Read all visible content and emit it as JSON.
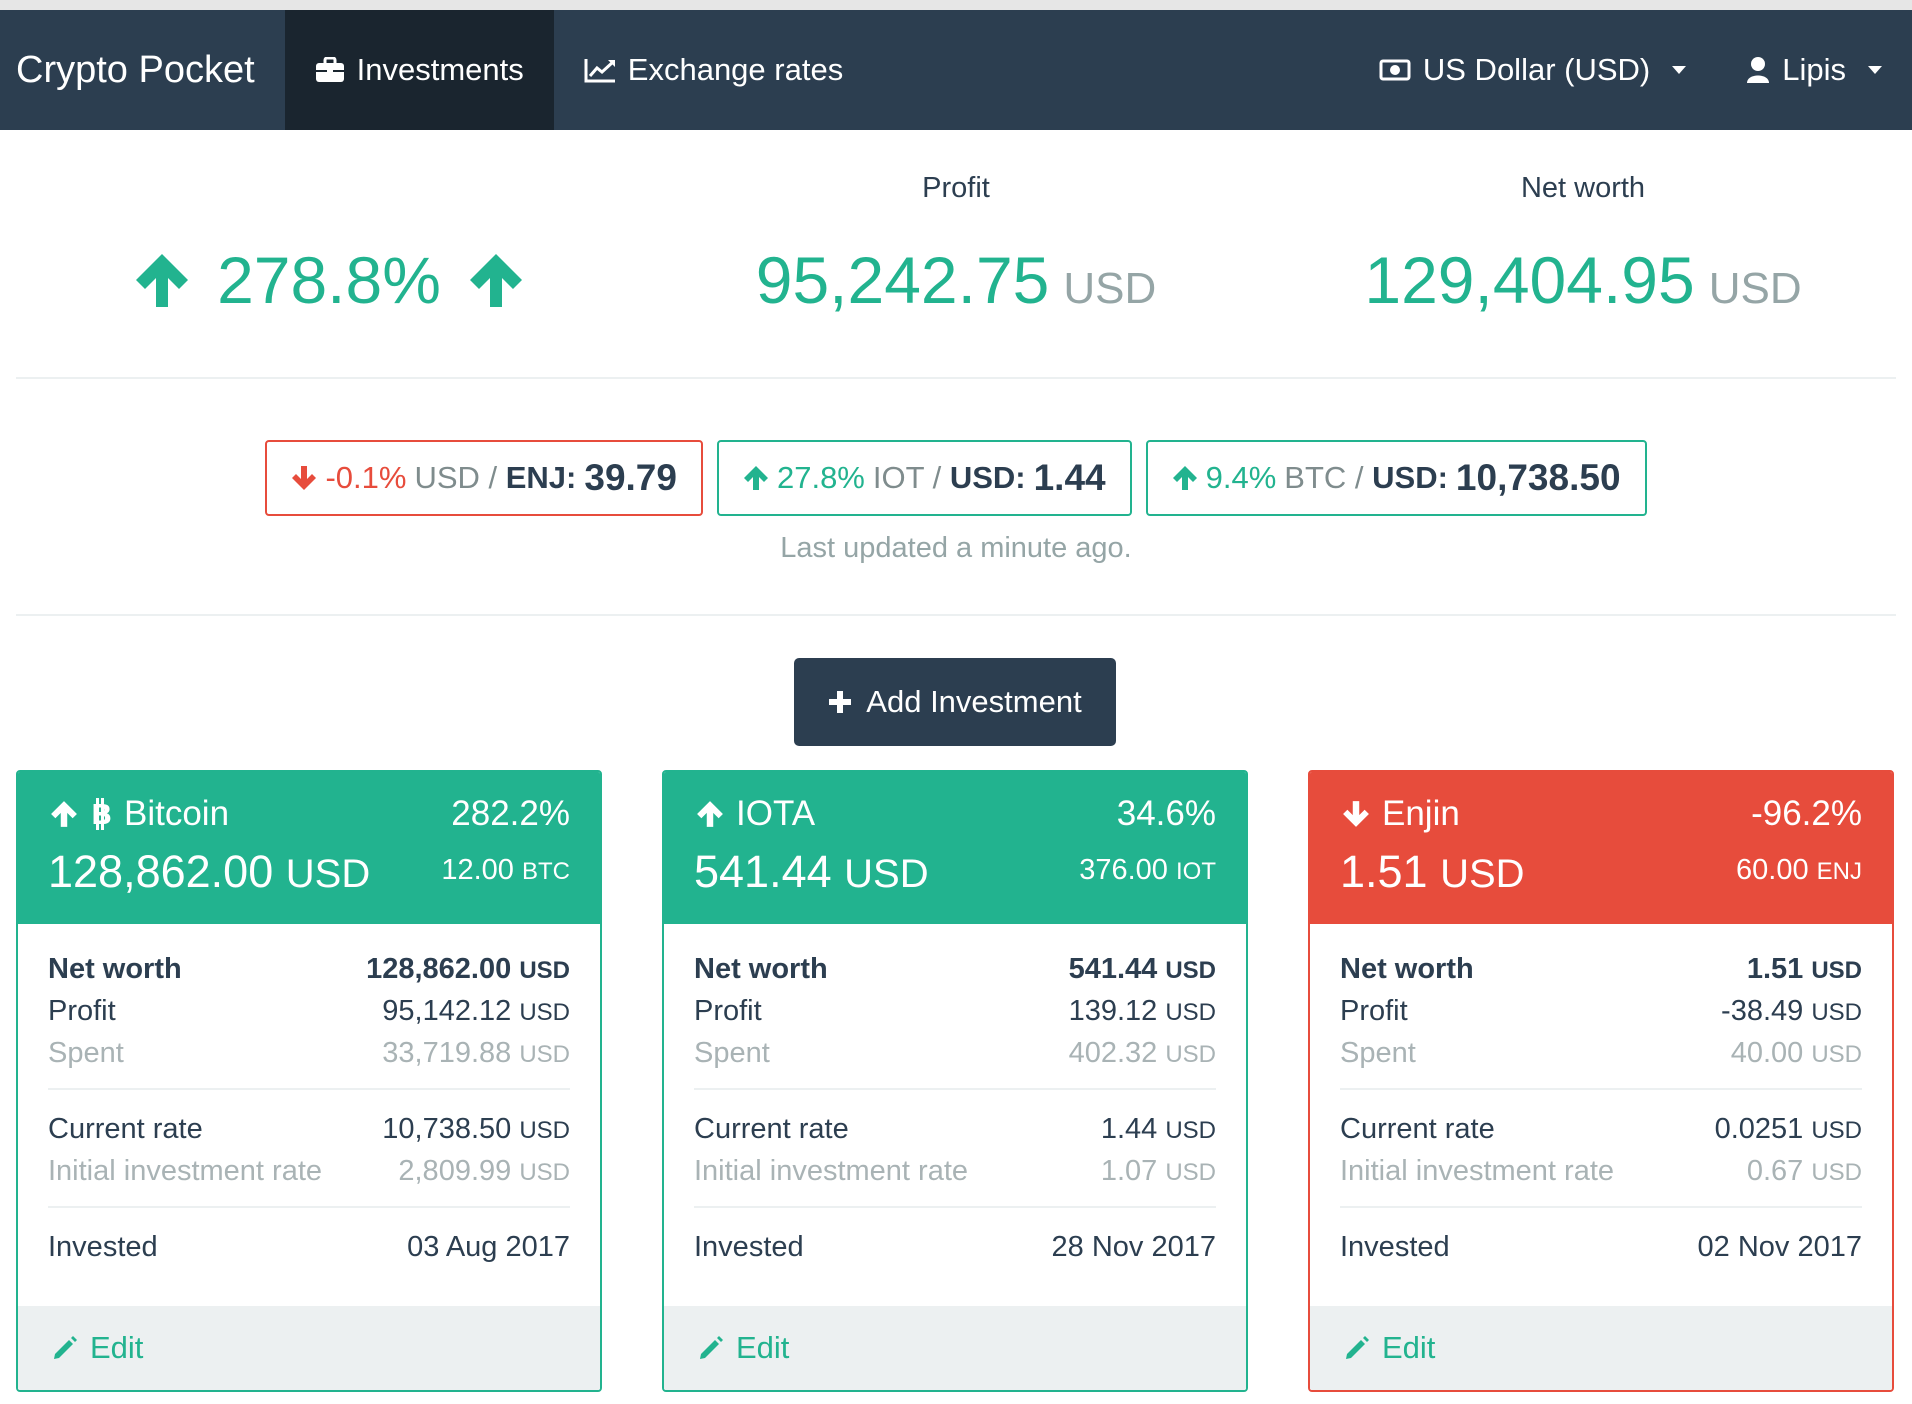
{
  "nav": {
    "brand": "Crypto Pocket",
    "items": [
      {
        "label": "Investments",
        "icon": "briefcase-icon",
        "active": true
      },
      {
        "label": "Exchange rates",
        "icon": "line-chart-icon",
        "active": false
      }
    ],
    "currency_label": "US Dollar (USD)",
    "user_label": "Lipis"
  },
  "summary": {
    "percent": "278.8%",
    "profit_label": "Profit",
    "profit_value": "95,242.75",
    "profit_unit": "USD",
    "networth_label": "Net worth",
    "networth_value": "129,404.95",
    "networth_unit": "USD"
  },
  "rates": [
    {
      "trend": "down",
      "pct": "-0.1%",
      "base": "USD",
      "quote": "ENJ:",
      "value": "39.79"
    },
    {
      "trend": "up",
      "pct": "27.8%",
      "base": "IOT",
      "quote": "USD:",
      "value": "1.44"
    },
    {
      "trend": "up",
      "pct": "9.4%",
      "base": "BTC",
      "quote": "USD:",
      "value": "10,738.50"
    }
  ],
  "rates_updated": "Last updated a minute ago.",
  "add_button": "Add Investment",
  "labels": {
    "net_worth": "Net worth",
    "profit": "Profit",
    "spent": "Spent",
    "current_rate": "Current rate",
    "initial_rate": "Initial investment rate",
    "invested": "Invested",
    "edit": "Edit",
    "usd": "USD"
  },
  "cards": [
    {
      "trend": "up",
      "name": "Bitcoin",
      "pct": "282.2%",
      "worth": "128,862.00",
      "worth_unit": "USD",
      "amount": "12.00",
      "amount_unit": "BTC",
      "net_worth": "128,862.00",
      "profit": "95,142.12",
      "spent": "33,719.88",
      "current_rate": "10,738.50",
      "initial_rate": "2,809.99",
      "invested": "03 Aug 2017"
    },
    {
      "trend": "up",
      "name": "IOTA",
      "pct": "34.6%",
      "worth": "541.44",
      "worth_unit": "USD",
      "amount": "376.00",
      "amount_unit": "IOT",
      "net_worth": "541.44",
      "profit": "139.12",
      "spent": "402.32",
      "current_rate": "1.44",
      "initial_rate": "1.07",
      "invested": "28 Nov 2017"
    },
    {
      "trend": "down",
      "name": "Enjin",
      "pct": "-96.2%",
      "worth": "1.51",
      "worth_unit": "USD",
      "amount": "60.00",
      "amount_unit": "ENJ",
      "net_worth": "1.51",
      "profit": "-38.49",
      "spent": "40.00",
      "current_rate": "0.0251",
      "initial_rate": "0.67",
      "invested": "02 Nov 2017"
    }
  ],
  "colors": {
    "navbar": "#2c3e50",
    "positive": "#22b38f",
    "negative": "#e74c3c",
    "muted": "#95a5a6"
  }
}
